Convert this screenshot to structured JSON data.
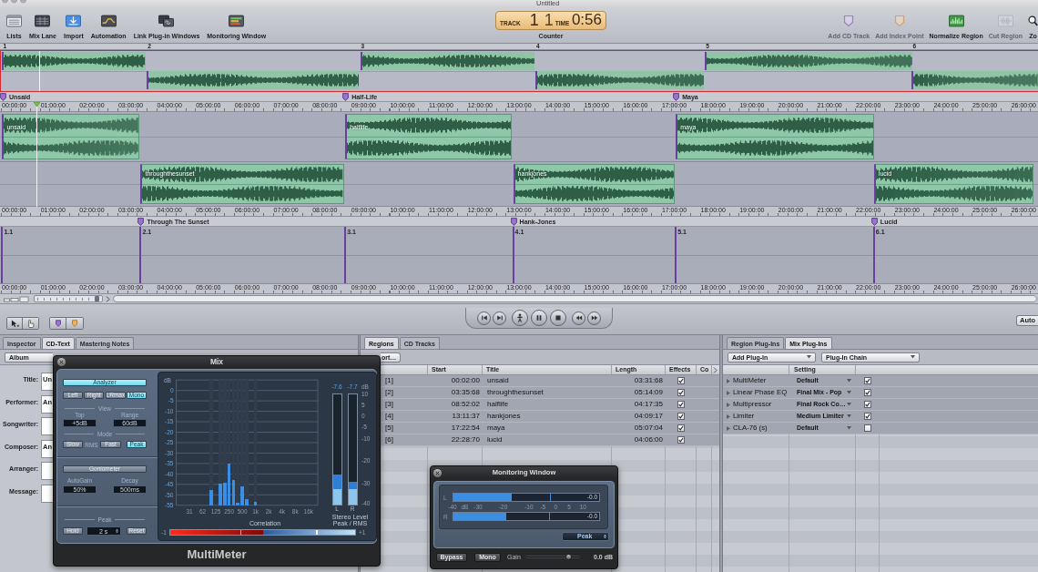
{
  "window": {
    "title": "Untitled"
  },
  "toolbar": {
    "left_buttons": [
      {
        "label": "Lists"
      },
      {
        "label": "Mix Lane"
      },
      {
        "label": "Import"
      },
      {
        "label": "Automation"
      },
      {
        "label": "Link Plug-in Windows"
      },
      {
        "label": "Monitoring Window"
      }
    ],
    "counter": {
      "track_caption": "TRACK",
      "track": "1",
      "index": "1",
      "time_caption": "TIME",
      "time": "0:56",
      "label": "Counter"
    },
    "right_buttons": [
      {
        "label": "Add CD Track",
        "disabled": true
      },
      {
        "label": "Add Index Point",
        "disabled": true
      },
      {
        "label": "Normalize Region",
        "disabled": false
      },
      {
        "label": "Cut Region",
        "disabled": true
      },
      {
        "label": "Zo",
        "disabled": false
      }
    ]
  },
  "overview": {
    "track_numbers": [
      "1",
      "2",
      "3",
      "4",
      "5",
      "6"
    ]
  },
  "marker_lanes": [
    {
      "markers": [
        "Unsaid",
        "Half-Life",
        "Maya"
      ]
    },
    {
      "markers": [
        "Through The Sunset",
        "Hank-Jones",
        "Lucid"
      ]
    }
  ],
  "rulers": [
    {
      "ticks": [
        "00:00:00",
        "01:00:00",
        "02:00:00",
        "03:00:00",
        "04:00:00",
        "05:00:00",
        "06:00:00",
        "07:00:00",
        "08:00:00",
        "09:00:00",
        "10:00:00",
        "11:00:00",
        "12:00:00",
        "13:00:00",
        "14:00:00",
        "15:00:00",
        "16:00:00",
        "17:00:00",
        "18:00:00",
        "19:00:00",
        "20:00:00",
        "21:00:00",
        "22:00:00",
        "23:00:00",
        "24:00:00",
        "25:00:00",
        "26:00:00"
      ]
    },
    {
      "ticks": [
        "00:00:00",
        "01:00:00",
        "02:00:00",
        "03:00:00",
        "04:00:00",
        "05:00:00",
        "06:00:00",
        "07:00:00",
        "08:00:00",
        "09:00:00",
        "10:00:00",
        "11:00:00",
        "12:00:00",
        "13:00:00",
        "14:00:00",
        "15:00:00",
        "16:00:00",
        "17:00:00",
        "18:00:00",
        "19:00:00",
        "20:00:00",
        "21:00:00",
        "22:00:00",
        "23:00:00",
        "24:00:00",
        "25:00:00",
        "26:00:00"
      ]
    },
    {
      "ticks": [
        "00:00:00",
        "01:00:00",
        "02:00:00",
        "03:00:00",
        "04:00:00",
        "05:00:00",
        "06:00:00",
        "07:00:00",
        "08:00:00",
        "09:00:00",
        "10:00:00",
        "11:00:00",
        "12:00:00",
        "13:00:00",
        "14:00:00",
        "15:00:00",
        "16:00:00",
        "17:00:00",
        "18:00:00",
        "19:00:00",
        "20:00:00",
        "21:00:00",
        "22:00:00",
        "23:00:00",
        "24:00:00",
        "25:00:00",
        "26:00:00"
      ]
    }
  ],
  "tracks": [
    {
      "regions": [
        "unsaid",
        "halflife",
        "maya"
      ]
    },
    {
      "regions": [
        "throughthesunset",
        "hankjones",
        "lucid"
      ]
    }
  ],
  "index_points": [
    "1.1",
    "2.1",
    "3.1",
    "4.1",
    "5.1",
    "6.1"
  ],
  "zoom_slider": {
    "level": 0.96
  },
  "transport": {
    "auto_button": "Auto"
  },
  "cd_text_panel": {
    "tabs": [
      {
        "label": "Inspector",
        "selected": false
      },
      {
        "label": "CD-Text",
        "selected": true
      },
      {
        "label": "Mastering Notes",
        "selected": false
      }
    ],
    "scope": "Album",
    "fields": [
      {
        "label": "Title:",
        "value": "Un"
      },
      {
        "label": "Performer:",
        "value": "An"
      },
      {
        "label": "Songwriter:"
      },
      {
        "label": "Composer:",
        "value": "An"
      },
      {
        "label": "Arranger:"
      },
      {
        "label": "Message:"
      }
    ]
  },
  "mix_window": {
    "title": "Mix",
    "analyzer": {
      "label": "Analyzer",
      "on": true
    },
    "channels": [
      {
        "label": "Left",
        "selected": false
      },
      {
        "label": "Right",
        "selected": false
      },
      {
        "label": "LRmax",
        "selected": false
      },
      {
        "label": "Mono",
        "selected": true
      }
    ],
    "view": {
      "label": "View",
      "top_label": "Top",
      "top": "+5dB",
      "range_label": "Range",
      "range": "60dB"
    },
    "mode": {
      "label": "Mode",
      "rms_speeds": [
        {
          "label": "Slow",
          "selected": false
        },
        {
          "label": "Fast",
          "selected": false
        }
      ],
      "rms_label": "RMS",
      "peak": {
        "label": "Peak",
        "on": true
      }
    },
    "goniometer": {
      "label": "Goniometer",
      "on": false
    },
    "autogain": {
      "label": "AutoGain",
      "value": "50%"
    },
    "decay": {
      "label": "Decay",
      "value": "500ms"
    },
    "peak_hold": {
      "label": "Peak",
      "hold": "Hold",
      "time": "2 s",
      "reset": "Reset"
    },
    "spectrum": {
      "unit": "dB",
      "scale": [
        "0",
        "-5",
        "-10",
        "-15",
        "-20",
        "-25",
        "-30",
        "-35",
        "-40",
        "-45",
        "-50",
        "-55"
      ],
      "bars": [
        {
          "level": 0.12
        },
        {
          "level": 0.17
        },
        {
          "level": 0.18
        },
        {
          "level": 0.33
        },
        {
          "level": 0.2
        },
        {
          "level": 0.02
        },
        {
          "level": 0.15
        },
        {
          "level": 0.05
        },
        {
          "level": 0.03
        }
      ],
      "band_labels": [
        "31",
        "62",
        "125",
        "250",
        "500",
        "1k",
        "2k",
        "4k",
        "8k",
        "16k"
      ]
    },
    "level_meters": {
      "unit": "dB",
      "scale": [
        "10",
        "5",
        "0",
        "-5",
        "-10",
        "-20",
        "-30",
        "-40"
      ],
      "channels": [
        {
          "label": "L",
          "reading": "-7.6",
          "peak": {
            "level": 0.27
          },
          "rms": {
            "level": 0.14
          }
        },
        {
          "label": "R",
          "reading": "-7.7",
          "peak": {
            "level": 0.21
          },
          "rms": {
            "level": 0.14
          }
        }
      ],
      "caption": "Stereo Level",
      "subcaption": "Peak / RMS"
    },
    "correlation": {
      "label": "Correlation",
      "min": "-1",
      "max": "+1",
      "level": 0.79,
      "hold": {
        "level": 0.38
      }
    },
    "plugin_name": "MultiMeter"
  },
  "regions_panel": {
    "tabs": [
      {
        "label": "Regions",
        "selected": true
      },
      {
        "label": "CD Tracks",
        "selected": false
      }
    ],
    "sort_button": "ort…",
    "columns": [
      "Start",
      "Title",
      "Length",
      "Effects",
      "Co"
    ],
    "rows": [
      {
        "index": "[1]",
        "start": "00:02:00",
        "title": "unsaid",
        "length": "03:31:68",
        "effects": true
      },
      {
        "index": "[2]",
        "start": "03:35:68",
        "title": "throughthesunset",
        "length": "05:14:09",
        "effects": true
      },
      {
        "index": "[3]",
        "start": "08:52:02",
        "title": "halflife",
        "length": "04:17:35",
        "effects": true
      },
      {
        "index": "[4]",
        "start": "13:11:37",
        "title": "hankjones",
        "length": "04:09:17",
        "effects": true
      },
      {
        "index": "[5]",
        "start": "17:22:54",
        "title": "maya",
        "length": "05:07:04",
        "effects": true
      },
      {
        "index": "[6]",
        "start": "22:28:70",
        "title": "lucid",
        "length": "04:06:00",
        "effects": true
      }
    ]
  },
  "monitoring_window": {
    "title": "Monitoring Window",
    "meters": [
      {
        "label": "L",
        "level": 0.4,
        "peak": {
          "level": 0.66
        },
        "reading": "-0.0"
      },
      {
        "label": "R",
        "level": 0.36,
        "peak": {
          "level": 0.655
        },
        "reading": "-0.0"
      }
    ],
    "scale": [
      "-40",
      "dB",
      "-30",
      "-20",
      "-10",
      "-5",
      "0",
      "5",
      "10"
    ],
    "mode": "Peak",
    "bypass": {
      "label": "Bypass",
      "on": false
    },
    "mono": {
      "label": "Mono",
      "on": false
    },
    "gain": {
      "label": "Gain",
      "level": 0.8,
      "reading": "0.0 dB"
    }
  },
  "plugins_panel": {
    "tabs": [
      {
        "label": "Region Plug-Ins",
        "selected": false
      },
      {
        "label": "Mix Plug-Ins",
        "selected": true
      }
    ],
    "add_menu": "Add Plug-In",
    "chain_menu": "Plug-In Chain",
    "columns": [
      "Setting"
    ],
    "rows": [
      {
        "name": "MultiMeter",
        "setting": "Default",
        "enabled": true
      },
      {
        "name": "Linear Phase EQ",
        "setting": "Final Mix - Pop",
        "enabled": true
      },
      {
        "name": "Multipressor",
        "setting": "Final Rock Co…",
        "enabled": true
      },
      {
        "name": "Limiter",
        "setting": "Medium Limiter",
        "enabled": true
      },
      {
        "name": "CLA-76 (s)",
        "setting": "Default",
        "enabled": false
      }
    ]
  }
}
